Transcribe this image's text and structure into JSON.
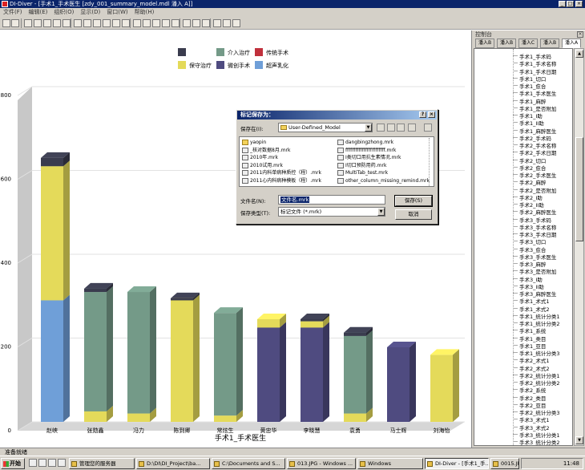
{
  "window": {
    "title": "DI-Diver - [手术1_手术医生 [zdy_001_summary_model.mdl 潘入 A]]",
    "min_label": "_",
    "max_label": "□",
    "close_label": "×"
  },
  "menu": [
    "文件(F)",
    "编辑(E)",
    "组织(O)",
    "显示(D)",
    "窗口(W)",
    "帮助(H)"
  ],
  "chart_data": {
    "type": "bar",
    "stacked": true,
    "xlabel": "手术1_手术医生",
    "ylabel": "",
    "ylim": [
      0,
      800
    ],
    "yticks": [
      0,
      200,
      400,
      600,
      800
    ],
    "categories": [
      "赵峡",
      "张勋鑫",
      "冯力",
      "陈到卿",
      "常炫生",
      "黄忠华",
      "李晓慧",
      "袁勇",
      "马士辉",
      "刘海怡"
    ],
    "series": [
      {
        "name": "超声乳化",
        "color": "#6f9fd8",
        "values": [
          290,
          0,
          0,
          0,
          0,
          0,
          0,
          0,
          0,
          0
        ]
      },
      {
        "name": "保守治疗",
        "color": "#e4da5a",
        "values": [
          320,
          25,
          20,
          290,
          15,
          0,
          0,
          20,
          0,
          160
        ]
      },
      {
        "name": "微创手术",
        "color": "#4f4b80",
        "values": [
          0,
          0,
          0,
          0,
          0,
          225,
          225,
          0,
          178,
          0
        ]
      },
      {
        "name": "保守治疗",
        "color": "#e4da5a",
        "values": [
          0,
          0,
          0,
          0,
          0,
          20,
          15,
          0,
          0,
          0
        ]
      },
      {
        "name": "介入治疗",
        "color": "#749a88",
        "values": [
          0,
          285,
          290,
          0,
          245,
          0,
          0,
          185,
          0,
          0
        ]
      },
      {
        "name": "",
        "color": "#3a3c4e",
        "values": [
          20,
          8,
          0,
          5,
          0,
          0,
          5,
          8,
          0,
          0
        ]
      }
    ],
    "legend": {
      "placement": "top-center",
      "items": [
        {
          "name": "",
          "color": "#3a3c4e"
        },
        {
          "name": "介入治疗",
          "color": "#749a88"
        },
        {
          "name": "传统手术",
          "color": "#c0303c"
        },
        {
          "name": "保守治疗",
          "color": "#e4da5a"
        },
        {
          "name": "微创手术",
          "color": "#4f4b80"
        },
        {
          "name": "超声乳化",
          "color": "#6f9fd8"
        }
      ]
    }
  },
  "panel": {
    "title": "控制台",
    "close_label": "×",
    "tabs": [
      "潘入B",
      "潘入B",
      "潘入C",
      "潘入B",
      "潘入A"
    ],
    "tree": [
      "手术1_手术码",
      "手术1_手术名称",
      "手术1_手术日期",
      "手术1_切口",
      "手术1_愈合",
      "手术1_手术医生",
      "手术1_麻醉",
      "手术1_是否附加",
      "手术1_I助",
      "手术1_II助",
      "手术1_麻醉医生",
      "手术2_手术码",
      "手术2_手术名称",
      "手术2_手术日期",
      "手术2_切口",
      "手术2_愈合",
      "手术2_手术医生",
      "手术2_麻醉",
      "手术2_是否附加",
      "手术2_I助",
      "手术2_II助",
      "手术2_麻醉医生",
      "手术3_手术码",
      "手术3_手术名称",
      "手术3_手术日期",
      "手术3_切口",
      "手术3_愈合",
      "手术3_手术医生",
      "手术3_麻醉",
      "手术3_是否附加",
      "手术3_I助",
      "手术3_II助",
      "手术3_麻醉医生",
      "手术1_术式1",
      "手术1_术式2",
      "手术1_统计分类1",
      "手术1_统计分类2",
      "手术1_系统",
      "手术1_类目",
      "手术1_亚目",
      "手术1_统计分类3",
      "手术2_术式1",
      "手术2_术式2",
      "手术2_统计分类1",
      "手术2_统计分类2",
      "手术2_系统",
      "手术2_类目",
      "手术2_亚目",
      "手术2_统计分类3",
      "手术3_术式1",
      "手术3_术式2",
      "手术3_统计分类1",
      "手术3_统计分类2"
    ]
  },
  "dialog": {
    "title": "标记保存为：",
    "help_label": "?",
    "close_label": "×",
    "save_in_label": "保存在(I):",
    "save_in_value": "User-Defined_Model",
    "files_left": [
      "yaopin",
      "_核对数据8月.mrk",
      "2010年.mrk",
      "2010试用.mrk",
      "2011内科单病种质控（程）.mrk",
      "2011心内科病种模板（程）.mrk"
    ],
    "files_right": [
      "dangbingzhong.mrk",
      "ffffffffffffffffffffffff.mrk",
      "I类切口用抗生素情况.mrk",
      "I切口预防用药.mrk",
      "MultiTab_test.mrk",
      "other_column_missing_remind.mrk"
    ],
    "filename_label": "文件名(N):",
    "filename_value": "文件名.mrk",
    "filetype_label": "保存类型(T):",
    "filetype_value": "标记文件 (*.mrk)",
    "save_button": "保存(S)",
    "cancel_button": "取消"
  },
  "statusbar": {
    "text": "准备就绪"
  },
  "taskbar": {
    "start": "开始",
    "tasks": [
      "管理您的服务器",
      "D:\\DI\\DI_Project\\ba...",
      "C:\\Documents and S...",
      "013.JPG - Windows ...",
      "Windows",
      "DI-Diver - [手术1_手...",
      "0015.JPG - 画图"
    ],
    "active_index": 5,
    "clock": "11:48"
  }
}
